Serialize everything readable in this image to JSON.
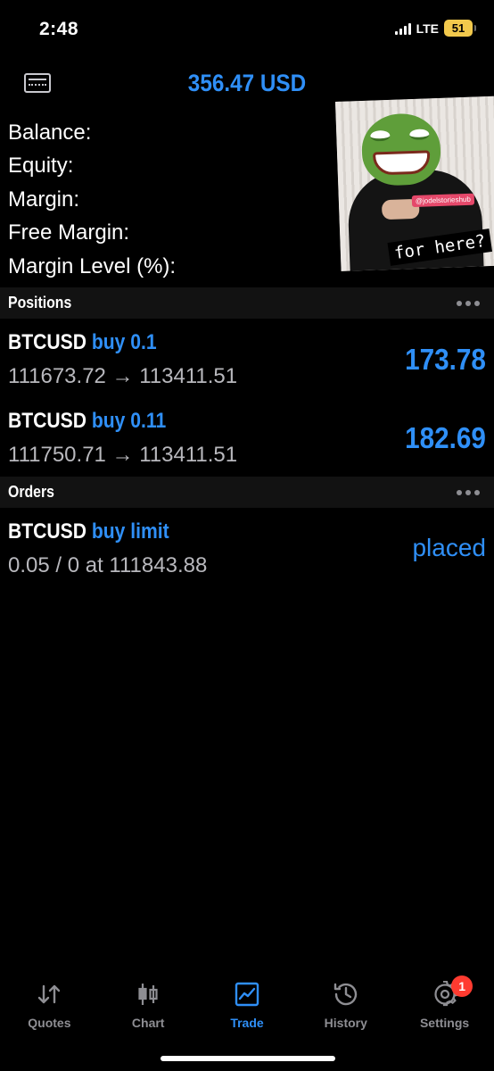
{
  "status_bar": {
    "time": "2:48",
    "network": "LTE",
    "battery": "51"
  },
  "header": {
    "title": "356.47 USD",
    "left_icon": "account-card-icon"
  },
  "summary": {
    "rows": [
      {
        "label": "Balance:",
        "value": ""
      },
      {
        "label": "Equity:",
        "value": ""
      },
      {
        "label": "Margin:",
        "value": ""
      },
      {
        "label": "Free Margin:",
        "value": ""
      },
      {
        "label": "Margin Level (%):",
        "value": ""
      }
    ]
  },
  "overlay_image": {
    "tag": "@jodelstorieshub",
    "caption": "for here?"
  },
  "positions": {
    "title": "Positions",
    "items": [
      {
        "symbol": "BTCUSD",
        "side": "buy 0.1",
        "prices": "111673.72 → 113411.51",
        "profit": "173.78"
      },
      {
        "symbol": "BTCUSD",
        "side": "buy 0.11",
        "prices": "111750.71 → 113411.51",
        "profit": "182.69"
      }
    ]
  },
  "orders": {
    "title": "Orders",
    "items": [
      {
        "symbol": "BTCUSD",
        "side": "buy limit",
        "details": "0.05 / 0 at 111843.88",
        "status": "placed"
      }
    ]
  },
  "tabbar": {
    "tabs": [
      {
        "label": "Quotes",
        "icon": "quotes-arrows-icon"
      },
      {
        "label": "Chart",
        "icon": "candlestick-icon"
      },
      {
        "label": "Trade",
        "icon": "trade-chart-icon",
        "active": true
      },
      {
        "label": "History",
        "icon": "history-clock-icon"
      },
      {
        "label": "Settings",
        "icon": "gear-icon",
        "badge": "1"
      }
    ]
  },
  "colors": {
    "accent": "#2f8ff7",
    "background": "#000000",
    "section_bar": "#121212",
    "badge": "#ff3b30"
  }
}
